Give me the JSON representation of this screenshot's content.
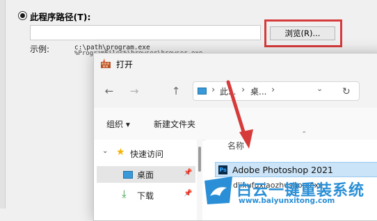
{
  "bg_dialog": {
    "path_label": "此程序路径(T):",
    "path_value": "",
    "browse_label": "浏览(R)...",
    "example_label": "示例:",
    "example_line1": "c:\\path\\program.exe",
    "example_line2": "%ProgramFiles%\\browser\\browser.exe"
  },
  "open_dialog": {
    "title": "打开",
    "nav": {
      "back": "←",
      "forward": "→",
      "up": "↑",
      "address": [
        "此...",
        "桌..."
      ],
      "dropdown": "⌄",
      "refresh": "↻"
    },
    "toolbar": {
      "organize": "组织 ▾",
      "new_folder": "新建文件夹"
    },
    "sidebar": {
      "items": [
        {
          "label": "快速访问",
          "icon": "star-icon"
        },
        {
          "label": "桌面",
          "icon": "desktop-icon",
          "selected": true
        },
        {
          "label": "下载",
          "icon": "download-icon"
        }
      ]
    },
    "files": {
      "column_name": "名称",
      "rows": [
        {
          "name": "Adobe Photoshop 2021",
          "icon": "photoshop-icon",
          "selected": true
        },
        {
          "name": "dlixufuxiaozhushou.exe",
          "icon": "exe-icon"
        }
      ]
    }
  },
  "watermark": {
    "title": "白云一键重装系统",
    "url": "www.baiyunxitong.com"
  },
  "colors": {
    "highlight_red": "#d63a3a",
    "selection_blue": "#cce4f7",
    "watermark_blue": "#2a8fd6"
  }
}
